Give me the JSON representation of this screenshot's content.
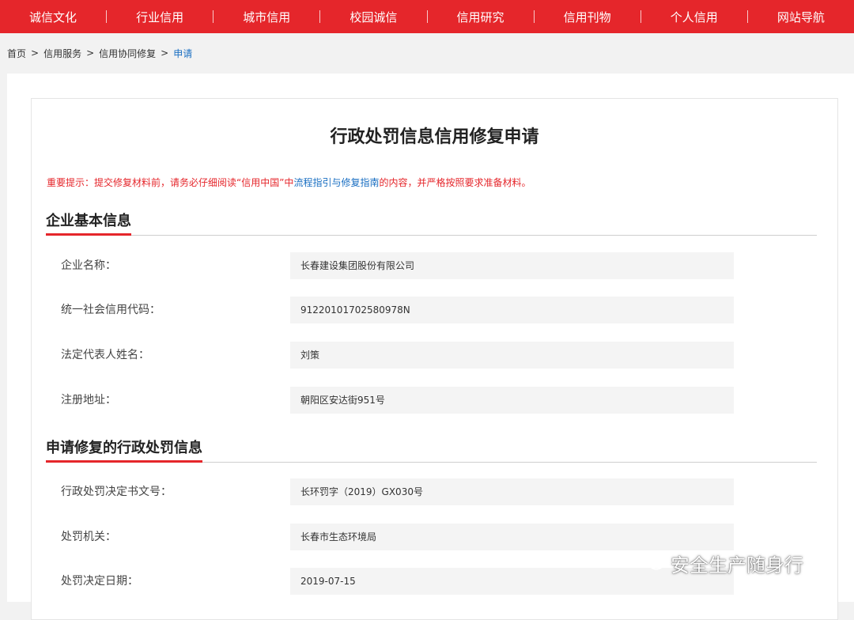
{
  "nav": [
    {
      "label": "诚信文化"
    },
    {
      "label": "行业信用"
    },
    {
      "label": "城市信用"
    },
    {
      "label": "校园诚信"
    },
    {
      "label": "信用研究"
    },
    {
      "label": "信用刊物"
    },
    {
      "label": "个人信用"
    },
    {
      "label": "网站导航"
    }
  ],
  "breadcrumb": {
    "home": "首页",
    "service": "信用服务",
    "repair": "信用协同修复",
    "current": "申请",
    "separator": ">"
  },
  "page_title": "行政处罚信息信用修复申请",
  "notice": {
    "prefix": "重要提示：提交修复材料前，请务必仔细阅读“信用中国”中",
    "link1": "流程指引",
    "middle": "与",
    "link2": "修复指南",
    "suffix": "的内容，并严格按照要求准备材料。"
  },
  "section_company": {
    "title": "企业基本信息",
    "fields": [
      {
        "label": "企业名称：",
        "value": "长春建设集团股份有限公司"
      },
      {
        "label": "统一社会信用代码：",
        "value": "91220101702580978N"
      },
      {
        "label": "法定代表人姓名：",
        "value": "刘策"
      },
      {
        "label": "注册地址：",
        "value": "朝阳区安达街951号"
      }
    ]
  },
  "section_penalty": {
    "title": "申请修复的行政处罚信息",
    "fields": [
      {
        "label": "行政处罚决定书文号：",
        "value": "长环罚字（2019）GX030号"
      },
      {
        "label": "处罚机关：",
        "value": "长春市生态环境局"
      },
      {
        "label": "处罚决定日期：",
        "value": "2019-07-15"
      }
    ]
  },
  "watermark": {
    "text": "安全生产随身行",
    "icon": "wechat-icon"
  },
  "colors": {
    "primary": "#e5262b",
    "link": "#1a6fc2",
    "field_bg": "#f4f4f4",
    "page_bg": "#f2f2f2"
  }
}
